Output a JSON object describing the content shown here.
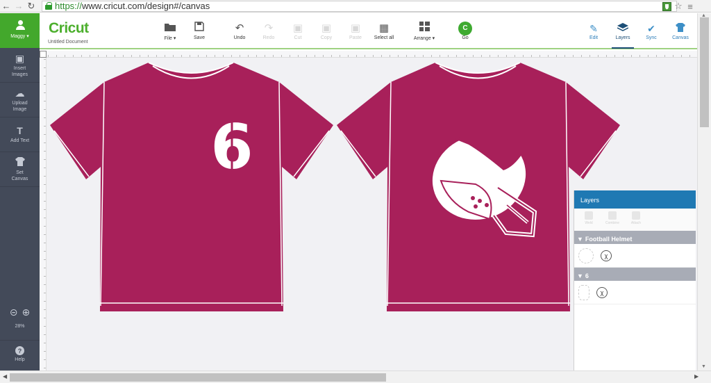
{
  "browser": {
    "back_icon": "back-arrow-icon",
    "forward_icon": "forward-arrow-icon",
    "reload_icon": "reload-icon",
    "url_scheme": "https://",
    "url_rest": "www.cricut.com/design#/canvas"
  },
  "header": {
    "logo": "Cricut",
    "document_name": "Untitled Document",
    "tools": [
      {
        "label": "File ▾",
        "icon": "folder-icon"
      },
      {
        "label": "Save",
        "icon": "save-icon"
      },
      {
        "label": "Undo",
        "icon": "undo-icon"
      },
      {
        "label": "Redo",
        "icon": "redo-icon"
      },
      {
        "label": "Cut",
        "icon": "cut-icon"
      },
      {
        "label": "Copy",
        "icon": "copy-icon"
      },
      {
        "label": "Paste",
        "icon": "paste-icon"
      },
      {
        "label": "Select all",
        "icon": "select-all-icon"
      },
      {
        "label": "Arrange ▾",
        "icon": "arrange-icon"
      },
      {
        "label": "Go",
        "icon": "go-icon"
      }
    ],
    "right_tools": [
      {
        "label": "Edit",
        "icon": "edit-icon"
      },
      {
        "label": "Layers",
        "icon": "layers-icon"
      },
      {
        "label": "Sync",
        "icon": "sync-icon"
      },
      {
        "label": "Canvas",
        "icon": "tshirt-icon"
      }
    ]
  },
  "sidebar": {
    "user": "Maggy ▾",
    "items": [
      {
        "label": "Insert Images",
        "icon": "image-icon"
      },
      {
        "label": "Upload Image",
        "icon": "upload-icon"
      },
      {
        "label": "Add Text",
        "icon": "text-icon"
      },
      {
        "label": "Set Canvas",
        "icon": "tshirt-icon"
      }
    ],
    "zoom": "28%",
    "help": "Help"
  },
  "canvas": {
    "shirt_color": "#a8205a",
    "front_number": "6"
  },
  "layers": {
    "title": "Layers",
    "tools": [
      "Weld",
      "Combine",
      "Attach"
    ],
    "groups": [
      {
        "name": "Football Helmet"
      },
      {
        "name": "6"
      }
    ]
  }
}
